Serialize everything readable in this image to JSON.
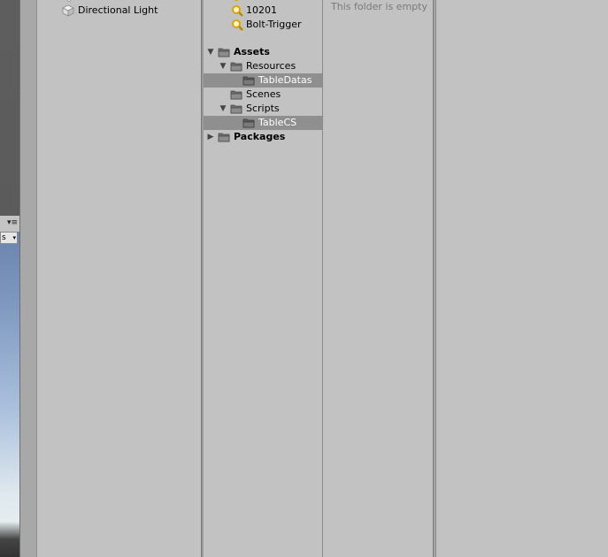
{
  "viewport": {
    "menu_glyph": "▾≡",
    "dropdown_label": "s",
    "dropdown_arrow": "▾"
  },
  "hierarchy": {
    "items": [
      {
        "label": "Directional Light",
        "icon": "cube-icon"
      }
    ]
  },
  "project_tree": {
    "search_results": [
      {
        "label": "10201",
        "icon": "search-filter-icon"
      },
      {
        "label": "Bolt-Trigger",
        "icon": "search-filter-icon"
      }
    ],
    "rows": [
      {
        "label": "Assets",
        "expanded": "▼",
        "bold": true
      },
      {
        "label": "Resources",
        "expanded": "▼"
      },
      {
        "label": "TableDatas",
        "selected": true
      },
      {
        "label": "Scenes"
      },
      {
        "label": "Scripts",
        "expanded": "▼"
      },
      {
        "label": "TableCS",
        "selected": true
      },
      {
        "label": "Packages",
        "expanded": "▶",
        "bold": true
      }
    ]
  },
  "contents": {
    "empty_message": "This folder is empty"
  },
  "colors": {
    "panel": "#c2c2c2",
    "selection": "#8f8f8f",
    "search_icon": "#d8a800"
  }
}
